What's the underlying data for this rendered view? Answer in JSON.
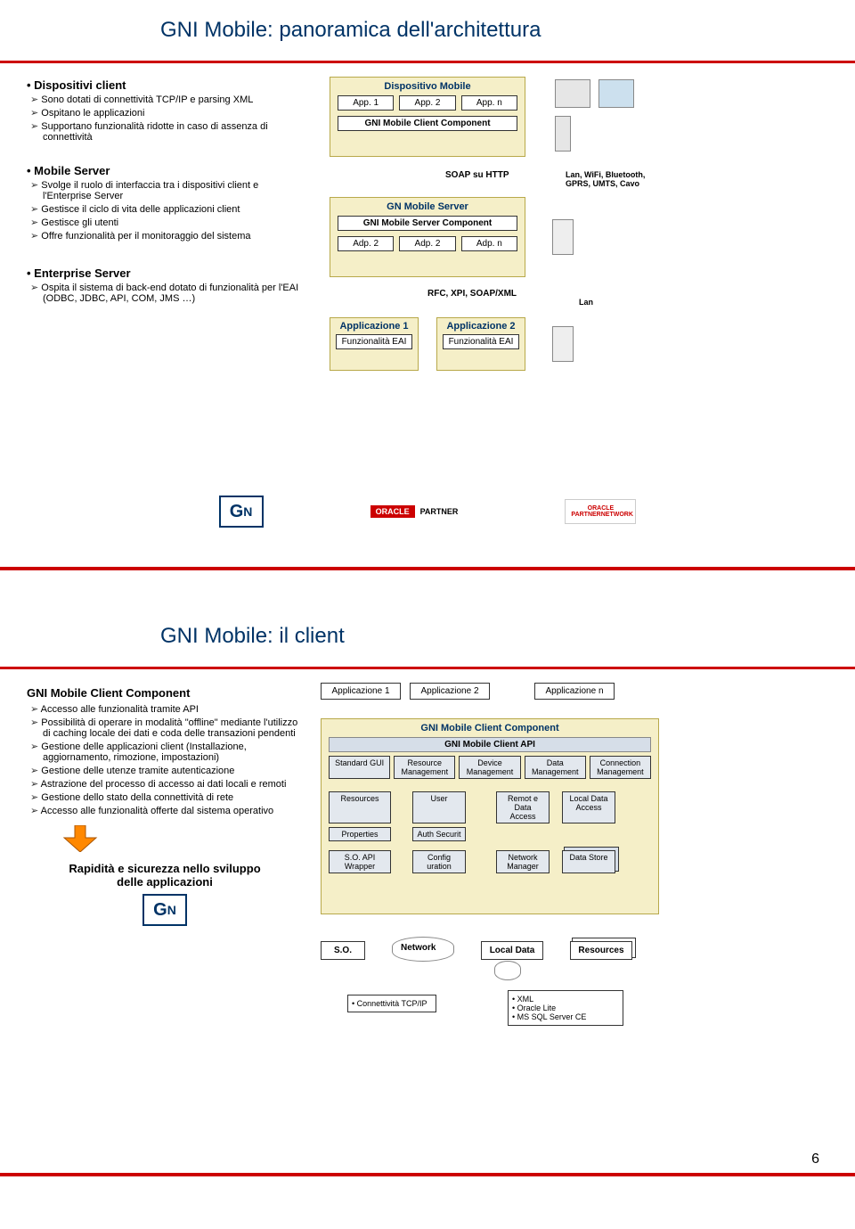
{
  "page_num": "6",
  "slide1": {
    "title": "GNI Mobile: panoramica dell'architettura",
    "s1h": "Dispositivi client",
    "s1b1": "Sono dotati di connettività TCP/IP e parsing XML",
    "s1b2": "Ospitano le applicazioni",
    "s1b3": "Supportano funzionalità ridotte in caso di assenza di connettività",
    "s2h": "Mobile Server",
    "s2b1": "Svolge il ruolo di interfaccia tra i dispositivi client e l'Enterprise Server",
    "s2b2": "Gestisce il ciclo di vita delle applicazioni client",
    "s2b3": "Gestisce gli utenti",
    "s2b4": "Offre funzionalità per il monitoraggio del sistema",
    "s3h": "Enterprise Server",
    "s3b1": "Ospita il sistema di back-end dotato di funzionalità per l'EAI (ODBC, JDBC, API, COM, JMS …)",
    "d_mobile": "Dispositivo Mobile",
    "app1": "App. 1",
    "app2": "App. 2",
    "appn": "App. n",
    "gnimcc": "GNI Mobile Client Component",
    "soap": "SOAP su HTTP",
    "gnserver": "GN Mobile Server",
    "gnimscmp": "GNI Mobile Server Component",
    "adp1": "Adp. 2",
    "adp2": "Adp. 2",
    "adpn": "Adp. n",
    "rfc": "RFC, XPI, SOAP/XML",
    "appl1": "Applicazione 1",
    "appl2": "Applicazione 2",
    "func": "Funzionalità EAI",
    "conn1": "Lan, WiFi, Bluetooth, GPRS, UMTS, Cavo",
    "conn2": "Lan",
    "oracle_p": "PARTNER",
    "opn": "ORACLE PARTNERNETWORK"
  },
  "slide2": {
    "title": "GNI Mobile: il client",
    "head": "GNI Mobile Client Component",
    "b1": "Accesso alle funzionalità tramite API",
    "b2": "Possibilità di operare in modalità \"offline\" mediante l'utilizzo di caching locale dei dati e coda delle transazioni pendenti",
    "b3": "Gestione delle applicazioni client (Installazione, aggiornamento, rimozione, impostazioni)",
    "b4": "Gestione delle utenze tramite autenticazione",
    "b5": "Astrazione del processo di accesso ai dati locali e remoti",
    "b6": "Gestione dello stato della connettività di rete",
    "b7": "Accesso alle funzionalità offerte dal sistema operativo",
    "callout": "Rapidità e sicurezza nello sviluppo delle applicazioni",
    "apps": {
      "a1": "Applicazione 1",
      "a2": "Applicazione 2",
      "an": "Applicazione n"
    },
    "cc": "GNI Mobile Client Component",
    "api": "GNI Mobile Client API",
    "row1": {
      "c1": "Standard GUI",
      "c2": "Resource Management",
      "c3": "Device Management",
      "c4": "Data Management",
      "c5": "Connection Management"
    },
    "row2": {
      "c1": "Resources",
      "c2": "User",
      "c3": "Remot e Data Access",
      "c4": "Local Data Access"
    },
    "row3": {
      "c1": "Properties",
      "c2": "Auth Securit"
    },
    "row4": {
      "c1": "S.O. API Wrapper",
      "c2": "Config uration",
      "c3": "Network Manager",
      "c4": "Data Store"
    },
    "os": "S.O.",
    "net": "Network",
    "ld": "Local Data",
    "res": "Resources",
    "tcp": "Connettività TCP/IP",
    "db": "XML",
    "db2": "Oracle Lite",
    "db3": "MS SQL Server CE"
  }
}
